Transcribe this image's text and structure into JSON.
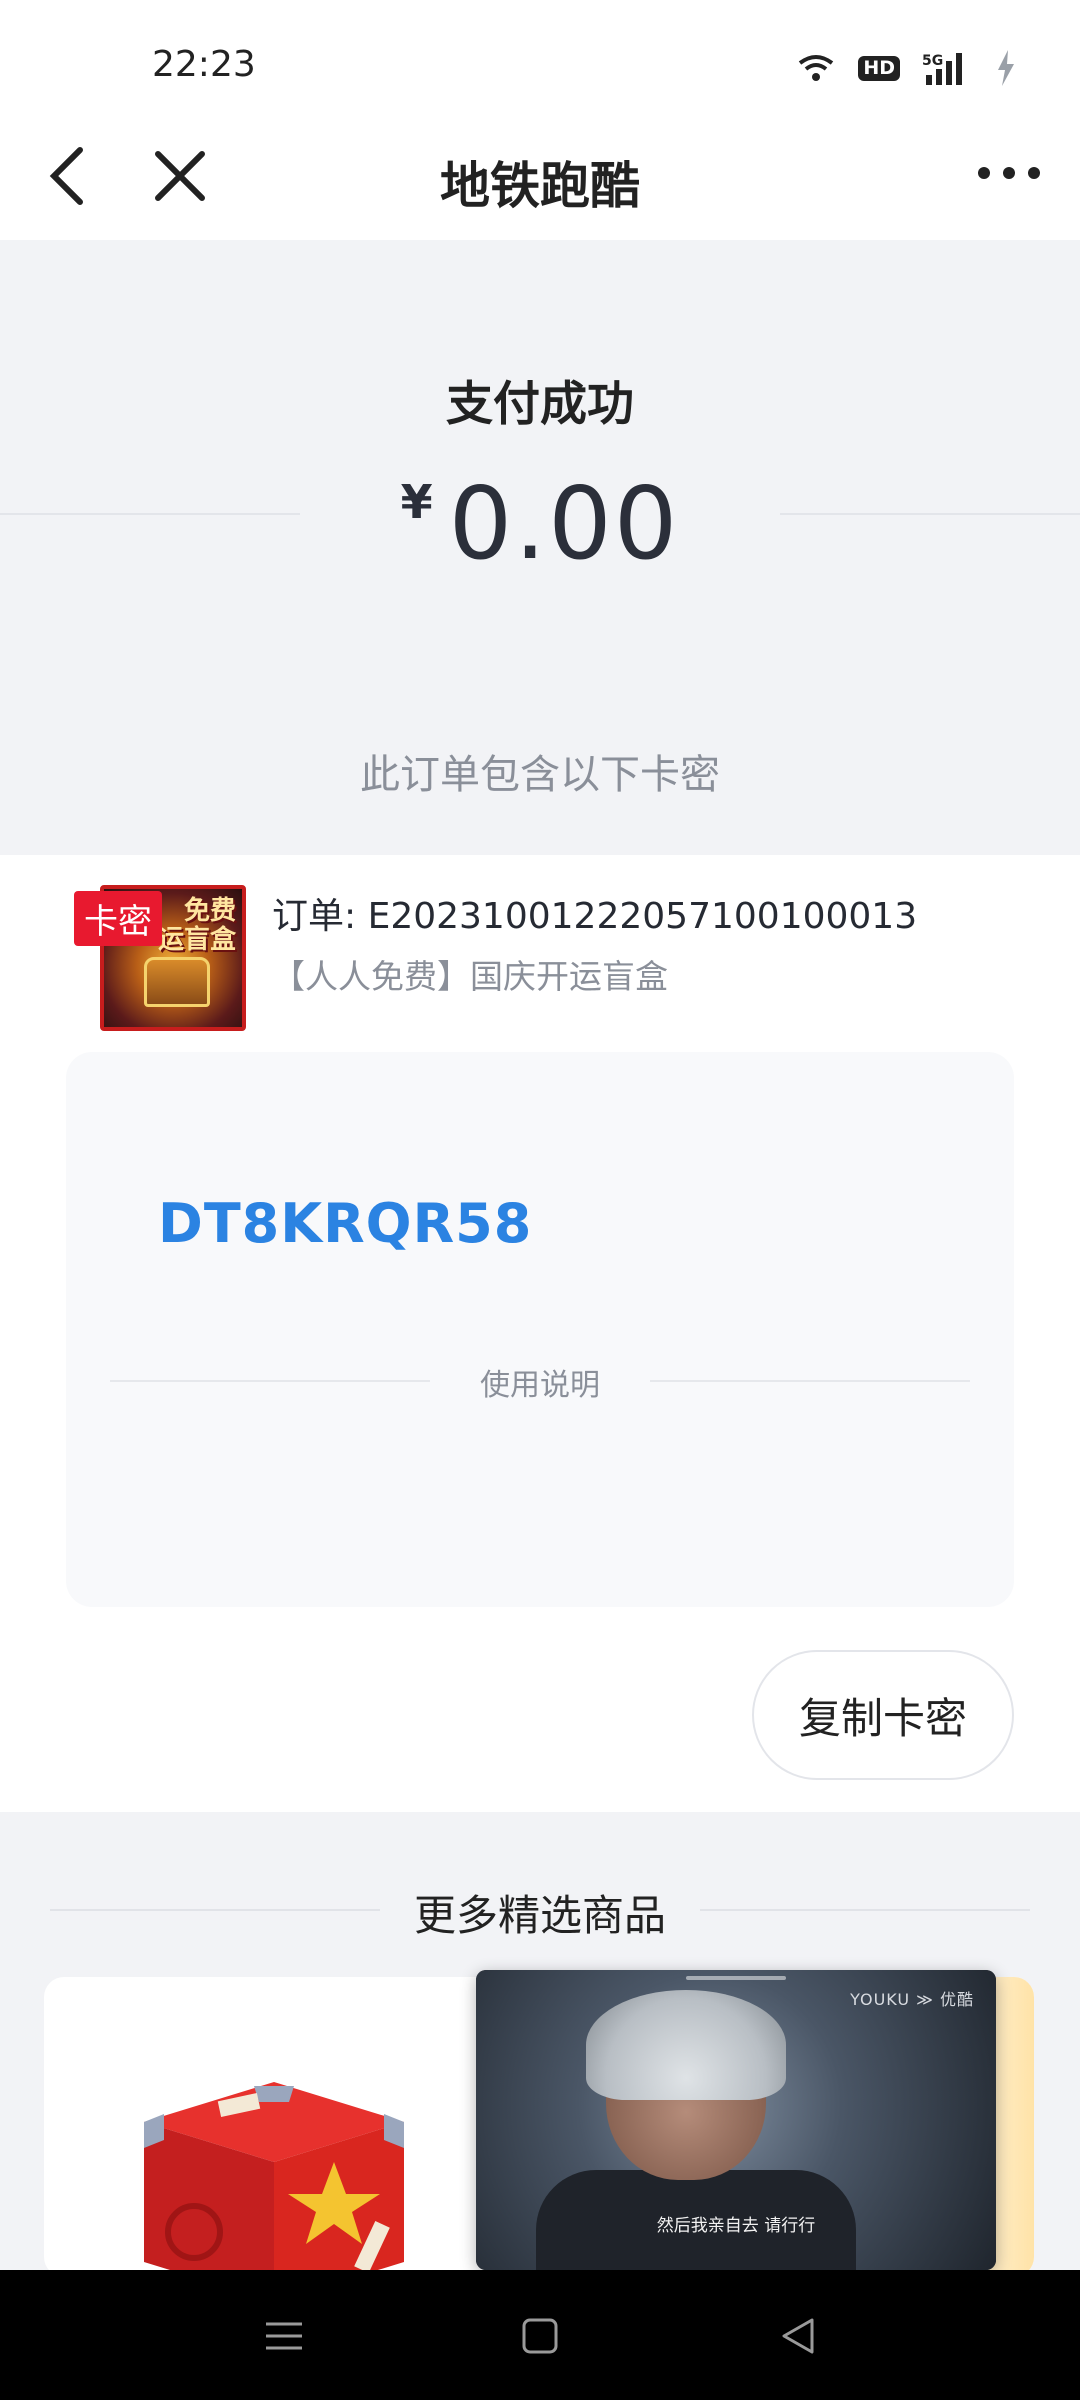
{
  "status_bar": {
    "time": "22:23",
    "hd_badge": "HD",
    "network": "5G",
    "icons": [
      "wifi-icon",
      "hd-icon",
      "signal-5g-icon",
      "battery-charging-icon"
    ]
  },
  "nav": {
    "title": "地铁跑酷",
    "icons": [
      "back-arrow-icon",
      "close-icon",
      "more-icon"
    ]
  },
  "payment": {
    "status": "支付成功",
    "currency": "¥",
    "amount": "0.00",
    "card_section_title": "此订单包含以下卡密"
  },
  "order": {
    "tag": "卡密",
    "thumb_text": "免费\n运盲盒",
    "order_label": "订单: E20231001222057100100013",
    "product_name": "【人人免费】国庆开运盲盒",
    "card_code": "DT8KRQR58",
    "usage_label": "使用说明",
    "copy_button": "复制卡密"
  },
  "more": {
    "title": "更多精选商品"
  },
  "video": {
    "brand": "YOUKU ≫ 优酷",
    "subtitle": "然后我亲自去  请行行"
  },
  "colors": {
    "accent_blue": "#2b83e2",
    "tag_red": "#e8192f",
    "background": "#f2f3f6"
  }
}
